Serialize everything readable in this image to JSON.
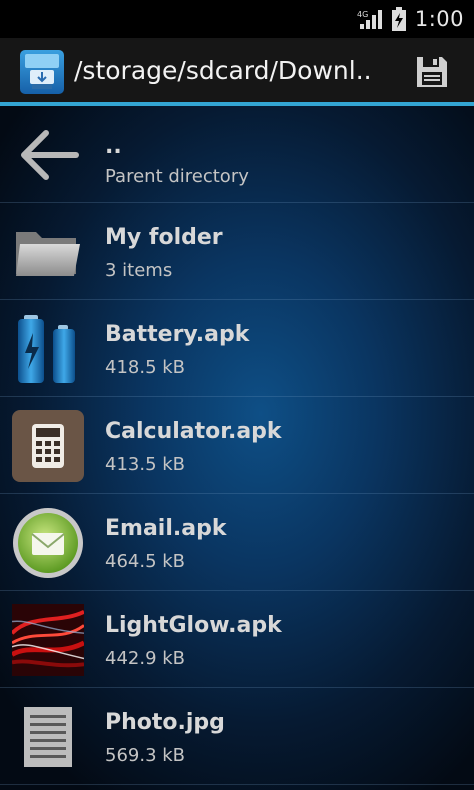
{
  "status_bar": {
    "time": "1:00",
    "signal_icon": "signal-icon",
    "battery_icon": "battery-charging-icon"
  },
  "action_bar": {
    "title": "/storage/sdcard/Downl...",
    "app_icon": "app-logo-icon",
    "save_icon": "floppy-disk-icon",
    "accent_color": "#33a5d3"
  },
  "files": [
    {
      "name": "..",
      "detail": "Parent directory",
      "icon": "back-arrow-icon"
    },
    {
      "name": "My folder",
      "detail": "3 items",
      "icon": "folder-icon"
    },
    {
      "name": "Battery.apk",
      "detail": "418.5 kB",
      "icon": "battery-app-icon"
    },
    {
      "name": "Calculator.apk",
      "detail": "413.5 kB",
      "icon": "calculator-icon"
    },
    {
      "name": "Email.apk",
      "detail": "464.5 kB",
      "icon": "email-icon"
    },
    {
      "name": "LightGlow.apk",
      "detail": "442.9 kB",
      "icon": "lightglow-icon"
    },
    {
      "name": "Photo.jpg",
      "detail": "569.3 kB",
      "icon": "document-icon"
    }
  ]
}
